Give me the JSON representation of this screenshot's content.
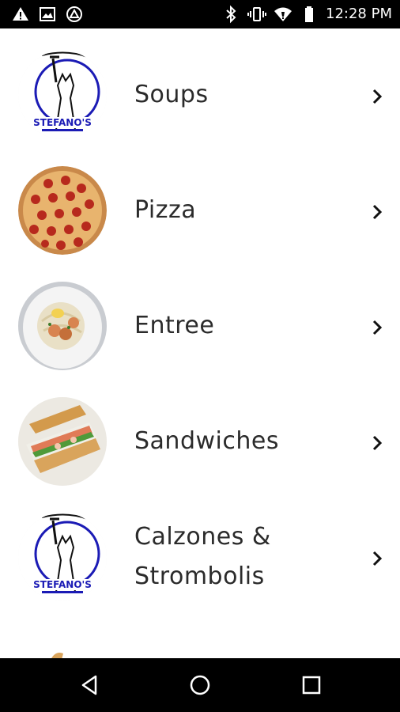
{
  "status_bar": {
    "time": "12:28 PM",
    "left_icons": [
      "warning-icon",
      "image-icon",
      "triangle-app-icon"
    ],
    "right_icons": [
      "bluetooth-icon",
      "vibrate-icon",
      "wifi-icon",
      "battery-icon"
    ]
  },
  "menu": {
    "items": [
      {
        "label": "Soups",
        "thumb": "stefanos-logo"
      },
      {
        "label": "Pizza",
        "thumb": "pepperoni-pizza"
      },
      {
        "label": "Entree",
        "thumb": "shrimp-pasta-plate"
      },
      {
        "label": "Sandwiches",
        "thumb": "sub-sandwich"
      },
      {
        "label": "Calzones & Strombolis",
        "label_line1": "Calzones &",
        "label_line2": "Strombolis",
        "thumb": "stefanos-logo"
      }
    ],
    "logo_text": "STEFANO'S"
  },
  "nav_bar": {
    "buttons": [
      "back-icon",
      "home-icon",
      "recents-icon"
    ]
  }
}
